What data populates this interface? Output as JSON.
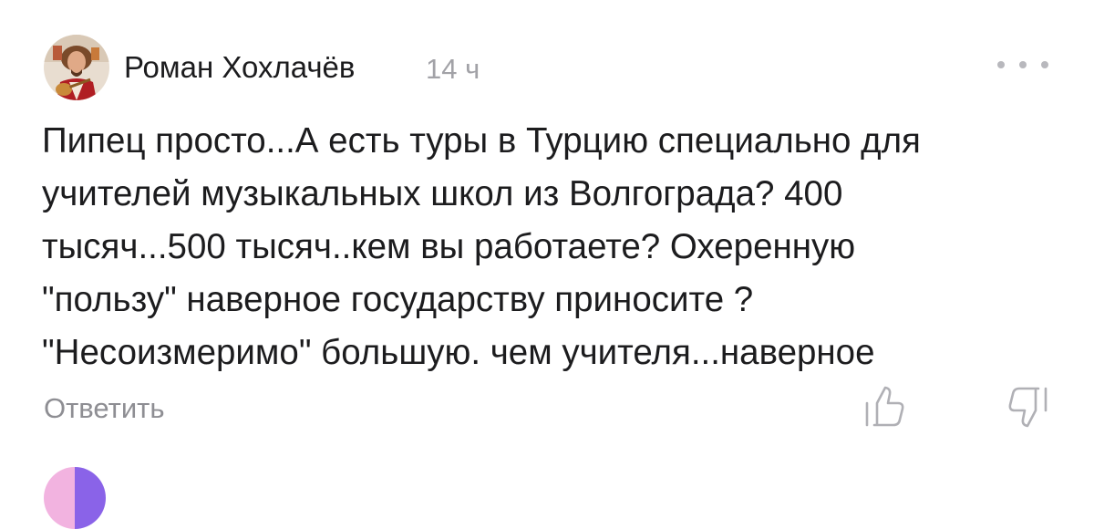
{
  "comment": {
    "author": "Роман Хохлачёв",
    "time": "14 ч",
    "text_lines": [
      "Пипец просто...А есть туры в Турцию специально для",
      "учителей музыкальных школ из Волгограда? 400",
      "тысяч...500 тысяч..кем вы работаете? Охеренную",
      "\"пользу\" наверное государству приносите ?",
      "\"Несоизмеримо\" большую. чем учителя...наверное"
    ],
    "reply_label": "Ответить",
    "icons": {
      "avatar": "avatar-photo",
      "more": "more-dots-icon",
      "like": "thumbs-up-icon",
      "dislike": "thumbs-down-icon"
    }
  },
  "colors": {
    "text": "#1c1c1e",
    "muted": "#8e8e93",
    "time": "#a2a2a7"
  }
}
